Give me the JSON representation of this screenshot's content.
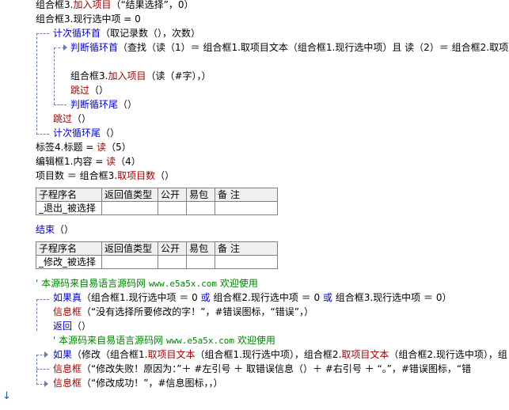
{
  "code_lines": {
    "l1": {
      "a": "组合框3.",
      "b": "加入项目",
      "c": "（“结果选择”，0）"
    },
    "l2": {
      "a": "组合框3.",
      "b": "现行选中项",
      "c": " = 0"
    },
    "l3": {
      "a": "计次循环首",
      "b": "（取记录数（），次数）"
    },
    "l4": {
      "a": "判断循环首",
      "b": "（查找（读（1）＝ 组合框1.取项目文本（组合框1.现行选中项）且 读（2）＝ 组合框2.取项"
    },
    "l5": {
      "a": "组合框3.",
      "b": "加入项目",
      "c": "（读（#字），）"
    },
    "l6": {
      "a": "跳过",
      "b": "（）"
    },
    "l7": {
      "a": "判断循环尾",
      "b": "（）"
    },
    "l8": {
      "a": "跳过",
      "b": "（）"
    },
    "l9": {
      "a": "计次循环尾",
      "b": "（）"
    },
    "l10": {
      "a": "标签4.",
      "b": "标题",
      "c": " = ",
      "d": "读",
      "e": "（5）"
    },
    "l11": {
      "a": "编辑框1.",
      "b": "内容",
      "c": " = ",
      "d": "读",
      "e": "（4）"
    },
    "l12": {
      "a": "项目数",
      "b": " ＝ 组合框3.",
      "c": "取项目数",
      "d": "（）"
    },
    "l13": {
      "a": "结束",
      "b": "（）"
    },
    "l14": {
      "a": "' 本源码来自易语言源码网 ",
      "b": "www.e5a5x.com",
      "c": "  欢迎使用"
    },
    "l15": {
      "a": "如果真",
      "b": "（组合框1.现行选中项 ＝ 0 ",
      "c": "或",
      "d": " 组合框2.现行选中项 ＝ 0 ",
      "e": "或",
      "f": " 组合框3.现行选中项 ＝ 0）"
    },
    "l16": {
      "a": "信息框",
      "b": "（“没有选择所要修改的字！”，#错误图标，“错误”，）"
    },
    "l17": {
      "a": "返回",
      "b": "（）"
    },
    "l18": {
      "a": "' 本源码来自易语言源码网 ",
      "b": "www.e5a5x.com",
      "c": "  欢迎使用"
    },
    "l19": {
      "a": "如果",
      "b": "（修改（组合框1.",
      "c": "取项目文本",
      "d": "（组合框1.现行选中项），组合框2.",
      "e": "取项目文本",
      "f": "（组合框2.现行选中项），组"
    },
    "l20": {
      "a": "信息框",
      "b": "（“修改失败！原因为：”＋ #左引号 ＋ 取错误信息（）＋ #右引号 ＋ “。”，#错误图标，“错"
    },
    "l21": {
      "a": "信息框",
      "b": "（“修改成功！”，#信息图标，，）"
    }
  },
  "table1": {
    "headers": [
      "子程序名",
      "返回值类型",
      "公开",
      "易包",
      "备 注"
    ],
    "row": [
      "_退出_被选择",
      "",
      "",
      "",
      ""
    ]
  },
  "table2": {
    "headers": [
      "子程序名",
      "返回值类型",
      "公开",
      "易包",
      "备 注"
    ],
    "row": [
      "_修改_被选择",
      "",
      "",
      "",
      ""
    ]
  },
  "margin_marker": "↓"
}
